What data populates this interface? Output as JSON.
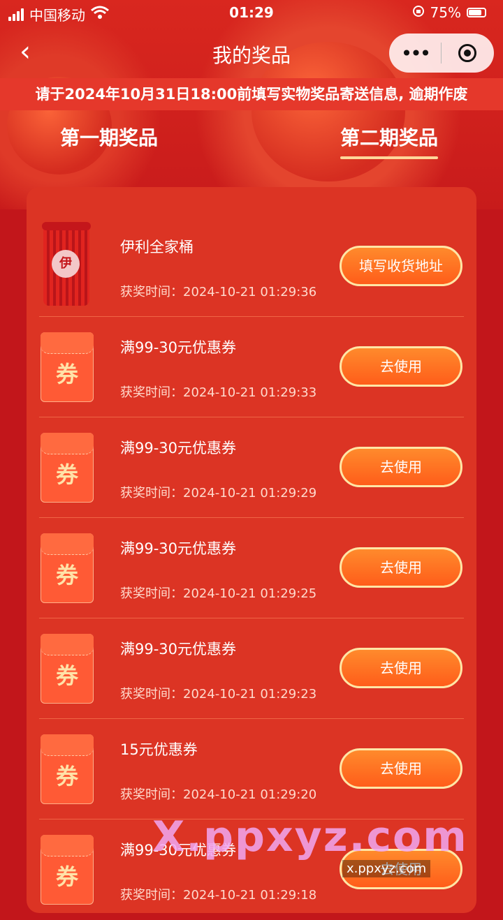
{
  "status": {
    "carrier": "中国移动",
    "time": "01:29",
    "battery": "75%"
  },
  "nav": {
    "back_glyph": "‹",
    "title": "我的奖品",
    "more_glyph": "•••"
  },
  "notice": "请于2024年10月31日18:00前填写实物奖品寄送信息, 逾期作废",
  "tabs": [
    {
      "label": "第一期奖品",
      "active": false
    },
    {
      "label": "第二期奖品",
      "active": true
    }
  ],
  "prizes": [
    {
      "name": "伊利全家桶",
      "time": "获奖时间：2024-10-21 01:29:36",
      "button": "填写收货地址",
      "thumb": "product-can",
      "logo_text": "伊"
    },
    {
      "name": "满99-30元优惠券",
      "time": "获奖时间：2024-10-21 01:29:33",
      "button": "去使用",
      "thumb": "coupon",
      "glyph": "券"
    },
    {
      "name": "满99-30元优惠券",
      "time": "获奖时间：2024-10-21 01:29:29",
      "button": "去使用",
      "thumb": "coupon",
      "glyph": "券"
    },
    {
      "name": "满99-30元优惠券",
      "time": "获奖时间：2024-10-21 01:29:25",
      "button": "去使用",
      "thumb": "coupon",
      "glyph": "券"
    },
    {
      "name": "满99-30元优惠券",
      "time": "获奖时间：2024-10-21 01:29:23",
      "button": "去使用",
      "thumb": "coupon",
      "glyph": "券"
    },
    {
      "name": "15元优惠券",
      "time": "获奖时间：2024-10-21 01:29:20",
      "button": "去使用",
      "thumb": "coupon",
      "glyph": "券"
    },
    {
      "name": "满99-30元优惠券",
      "time": "获奖时间：2024-10-21 01:29:18",
      "button": "去使用",
      "thumb": "coupon",
      "glyph": "券"
    }
  ],
  "watermark": {
    "big": "X.ppxyz.com",
    "small": "x.ppxyz.com"
  },
  "colors": {
    "page_bg": "#c2161b",
    "card_bg": "#dc3424",
    "button": "#ff6a22",
    "tab_underline": "#ffd79a"
  }
}
